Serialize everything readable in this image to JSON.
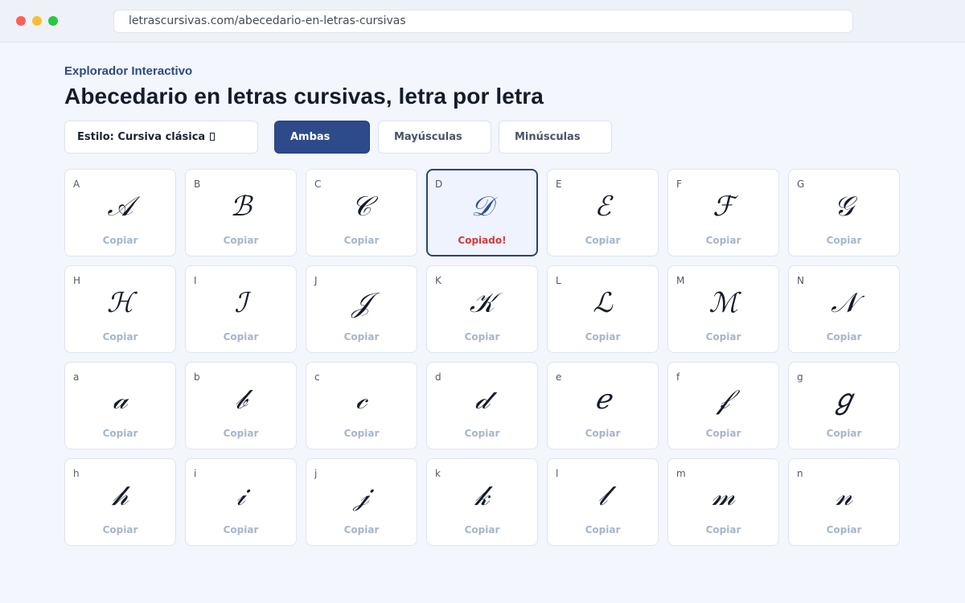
{
  "browser": {
    "url": "letrascursivas.com/abecedario-en-letras-cursivas"
  },
  "page": {
    "eyebrow": "Explorador Interactivo",
    "title": "Abecedario en letras cursivas, letra por letra"
  },
  "controls": {
    "style_label": "Estilo: Cursiva clásica",
    "filters": [
      {
        "label": "Ambas",
        "active": true
      },
      {
        "label": "Mayúsculas",
        "active": false
      },
      {
        "label": "Minúsculas",
        "active": false
      }
    ]
  },
  "colors": {
    "accent": "#2d4a8a",
    "copied": "#d23b3b",
    "copy_link": "#a5b6c9"
  },
  "letters": [
    {
      "key": "A",
      "glyph": "𝒜",
      "action": "Copiar"
    },
    {
      "key": "B",
      "glyph": "ℬ",
      "action": "Copiar"
    },
    {
      "key": "C",
      "glyph": "𝒞",
      "action": "Copiar"
    },
    {
      "key": "D",
      "glyph": "𝒟",
      "action": "Copiado!",
      "selected": true
    },
    {
      "key": "E",
      "glyph": "ℰ",
      "action": "Copiar"
    },
    {
      "key": "F",
      "glyph": "ℱ",
      "action": "Copiar"
    },
    {
      "key": "G",
      "glyph": "𝒢",
      "action": "Copiar"
    },
    {
      "key": "H",
      "glyph": "ℋ",
      "action": "Copiar"
    },
    {
      "key": "I",
      "glyph": "ℐ",
      "action": "Copiar"
    },
    {
      "key": "J",
      "glyph": "𝒥",
      "action": "Copiar"
    },
    {
      "key": "K",
      "glyph": "𝒦",
      "action": "Copiar"
    },
    {
      "key": "L",
      "glyph": "ℒ",
      "action": "Copiar"
    },
    {
      "key": "M",
      "glyph": "ℳ",
      "action": "Copiar"
    },
    {
      "key": "N",
      "glyph": "𝒩",
      "action": "Copiar"
    },
    {
      "key": "a",
      "glyph": "𝒶",
      "action": "Copiar"
    },
    {
      "key": "b",
      "glyph": "𝒷",
      "action": "Copiar"
    },
    {
      "key": "c",
      "glyph": "𝒸",
      "action": "Copiar"
    },
    {
      "key": "d",
      "glyph": "𝒹",
      "action": "Copiar"
    },
    {
      "key": "e",
      "glyph": "ℯ",
      "action": "Copiar"
    },
    {
      "key": "f",
      "glyph": "𝒻",
      "action": "Copiar"
    },
    {
      "key": "g",
      "glyph": "ℊ",
      "action": "Copiar"
    },
    {
      "key": "h",
      "glyph": "𝒽",
      "action": "Copiar"
    },
    {
      "key": "i",
      "glyph": "𝒾",
      "action": "Copiar"
    },
    {
      "key": "j",
      "glyph": "𝒿",
      "action": "Copiar"
    },
    {
      "key": "k",
      "glyph": "𝓀",
      "action": "Copiar"
    },
    {
      "key": "l",
      "glyph": "𝓁",
      "action": "Copiar"
    },
    {
      "key": "m",
      "glyph": "𝓂",
      "action": "Copiar"
    },
    {
      "key": "n",
      "glyph": "𝓃",
      "action": "Copiar"
    }
  ]
}
